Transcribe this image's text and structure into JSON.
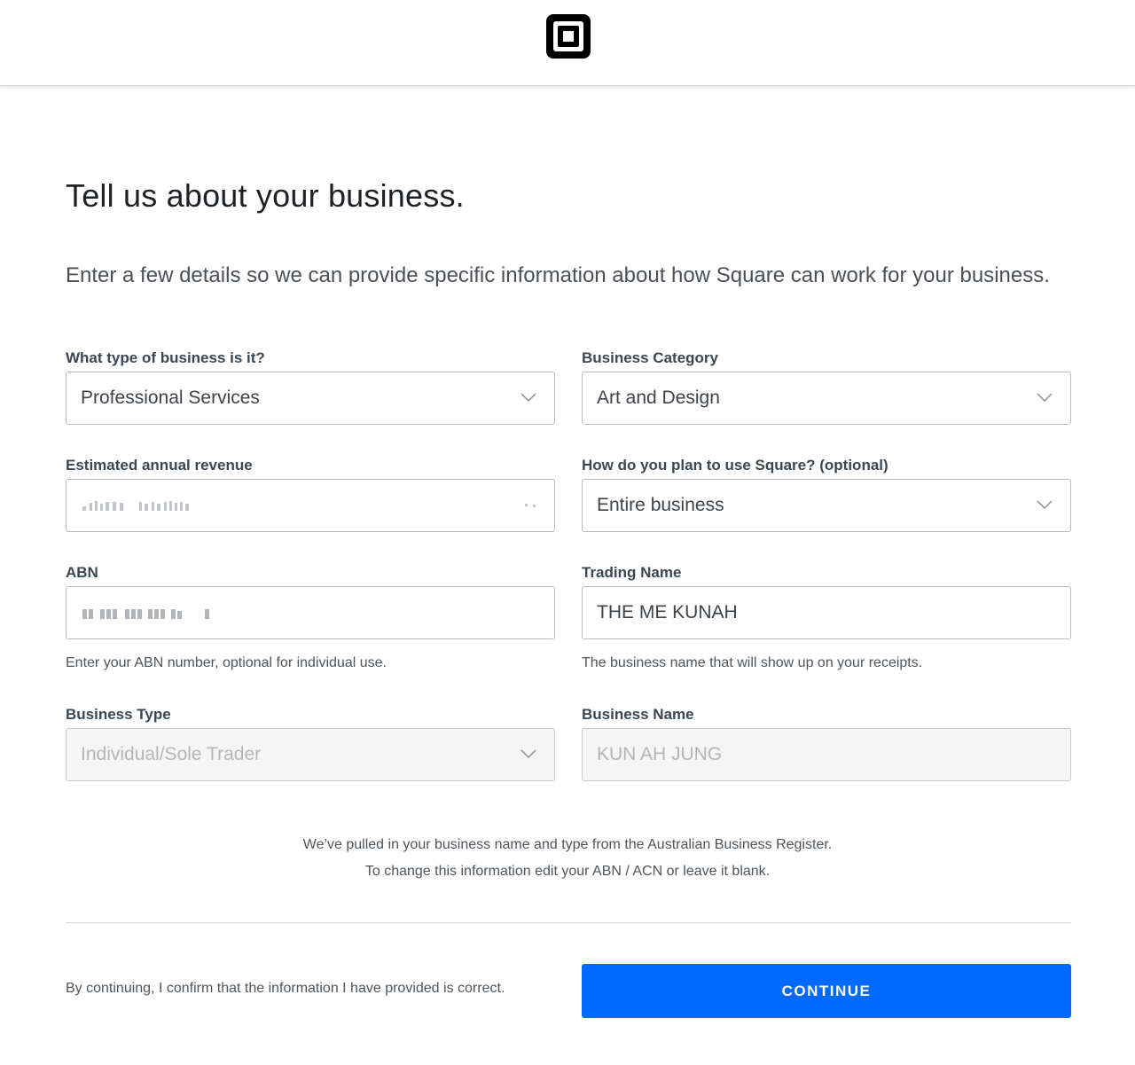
{
  "brand": {
    "logo_icon": "square-logo-icon",
    "accent_color": "#006aff"
  },
  "page": {
    "title": "Tell us about your business.",
    "intro": "Enter a few details so we can provide specific information about how Square can work for your business."
  },
  "fields": {
    "business_type_select": {
      "label": "What type of business is it?",
      "value": "Professional Services"
    },
    "business_category": {
      "label": "Business Category",
      "value": "Art and Design"
    },
    "annual_revenue": {
      "label": "Estimated annual revenue"
    },
    "square_use": {
      "label": "How do you plan to use Square? (optional)",
      "value": "Entire business"
    },
    "abn": {
      "label": "ABN",
      "hint": "Enter your ABN number, optional for individual use."
    },
    "trading_name": {
      "label": "Trading Name",
      "value": "THE ME KUNAH",
      "hint": "The business name that will show up on your receipts."
    },
    "business_type": {
      "label": "Business Type",
      "value": "Individual/Sole Trader"
    },
    "business_name": {
      "label": "Business Name",
      "value": "KUN AH JUNG"
    }
  },
  "register_note": {
    "line1": "We’ve pulled in your business name and type from the Australian Business Register.",
    "line2": "To change this information edit your ABN / ACN or leave it blank."
  },
  "footer": {
    "confirm_text": "By continuing, I confirm that the information I have provided is correct.",
    "continue_label": "CONTINUE"
  }
}
